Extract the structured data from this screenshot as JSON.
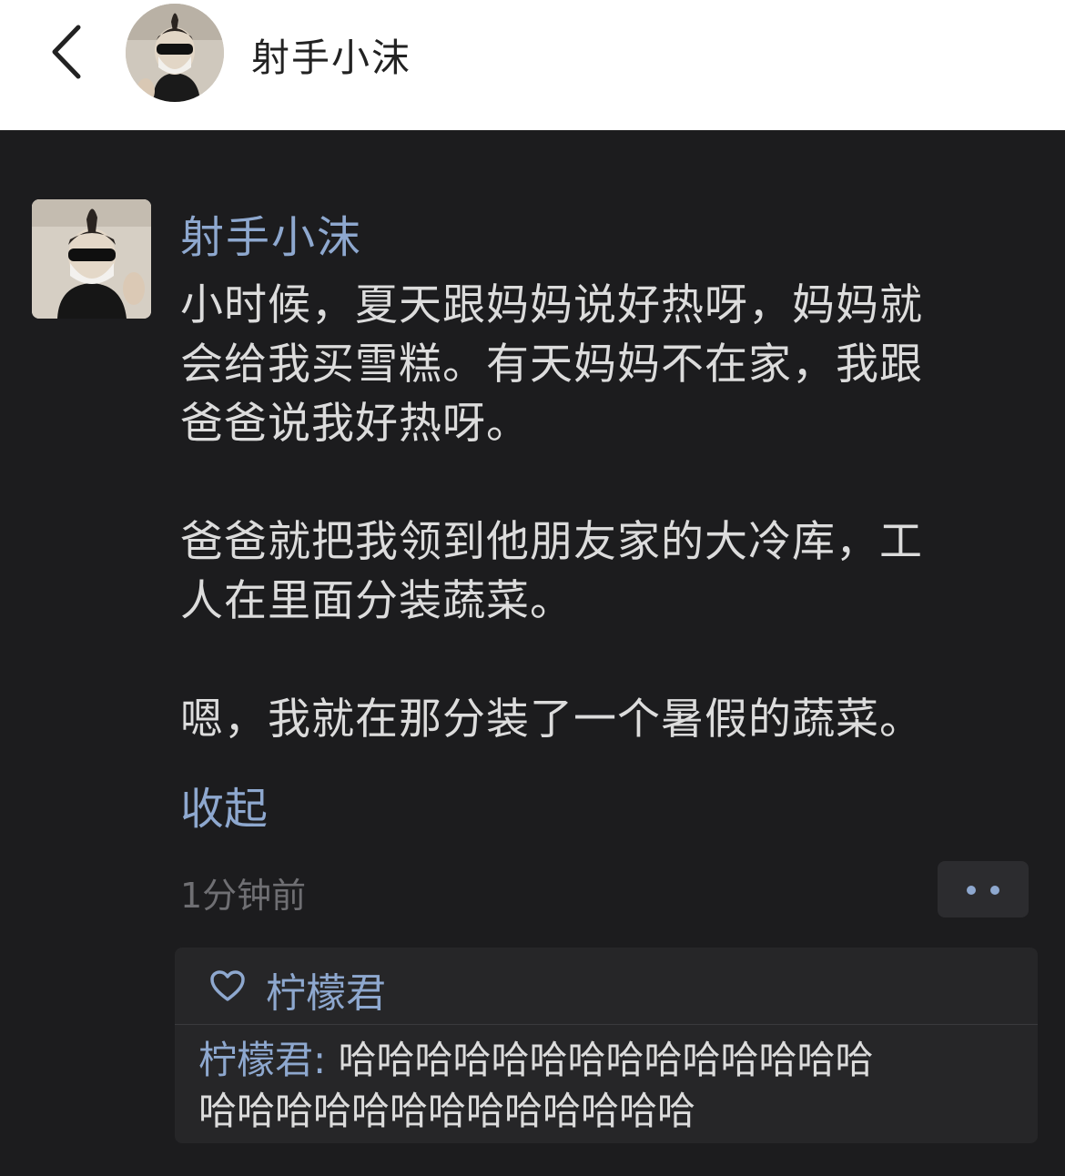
{
  "header": {
    "title": "射手小沫"
  },
  "post": {
    "author": "射手小沫",
    "lines": [
      "小时候，夏天跟妈妈说好热呀，妈妈就",
      "会给我买雪糕。有天妈妈不在家，我跟",
      "爸爸说我好热呀。",
      "爸爸就把我领到他朋友家的大冷库，工",
      "人在里面分装蔬菜。",
      "嗯，我就在那分装了一个暑假的蔬菜。"
    ],
    "collapse_label": "收起",
    "timestamp": "1分钟前"
  },
  "reactions": {
    "liker": "柠檬君"
  },
  "comment": {
    "author": "柠檬君",
    "separator": ":",
    "line1": "哈哈哈哈哈哈哈哈哈哈哈哈哈哈",
    "line2": "哈哈哈哈哈哈哈哈哈哈哈哈哈"
  },
  "colors": {
    "accent": "#8ea8cf",
    "background": "#1c1c1e",
    "text": "#dcdcdc",
    "muted": "#6f6f73"
  },
  "icons": {
    "back": "chevron-left-icon",
    "like": "heart-icon",
    "more": "more-dots-icon"
  }
}
